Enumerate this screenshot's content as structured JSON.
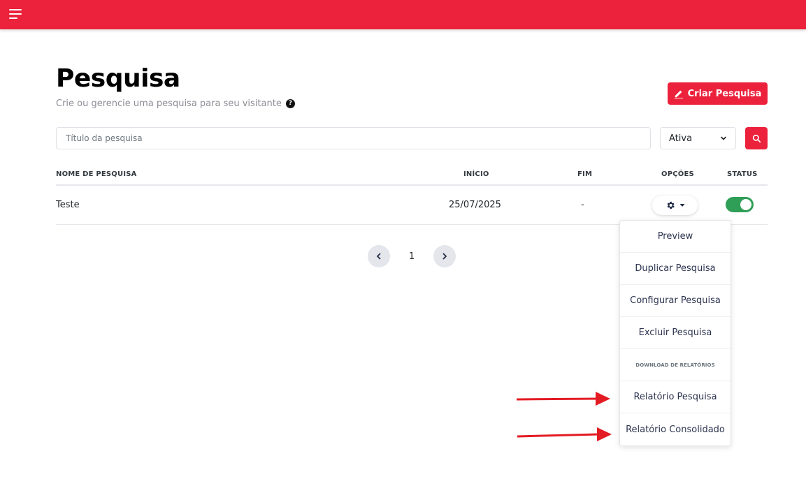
{
  "header": {
    "accent_color": "#ec213b",
    "menu_icon": "hamburger-menu-icon"
  },
  "page": {
    "title": "Pesquisa",
    "subtitle": "Crie ou gerencie uma pesquisa para seu visitante",
    "help_icon_glyph": "?",
    "create_button_label": "Criar Pesquisa",
    "create_button_icon": "pencil-icon"
  },
  "filters": {
    "search_placeholder": "Título da pesquisa",
    "search_value": "",
    "status_selected": "Ativa",
    "search_button_icon": "search-icon"
  },
  "table": {
    "columns": {
      "name": "NOME DE PESQUISA",
      "start": "INÍCIO",
      "end": "FIM",
      "options": "OPÇÕES",
      "status": "STATUS"
    },
    "rows": [
      {
        "name": "Teste",
        "start": "25/07/2025",
        "end": "-",
        "options_icon": "gear-icon",
        "status_active": true,
        "status_color": "#2f9e57"
      }
    ]
  },
  "pagination": {
    "current_page": "1",
    "prev_icon": "chevron-left-icon",
    "next_icon": "chevron-right-icon"
  },
  "options_menu": {
    "items": [
      "Preview",
      "Duplicar Pesquisa",
      "Configurar Pesquisa",
      "Excluir Pesquisa"
    ],
    "section_header": "DOWNLOAD DE RELATÓRIOS",
    "report_items": [
      "Relatório Pesquisa",
      "Relatório Consolidado"
    ]
  },
  "annotations": {
    "arrow_color": "#e31b23"
  }
}
